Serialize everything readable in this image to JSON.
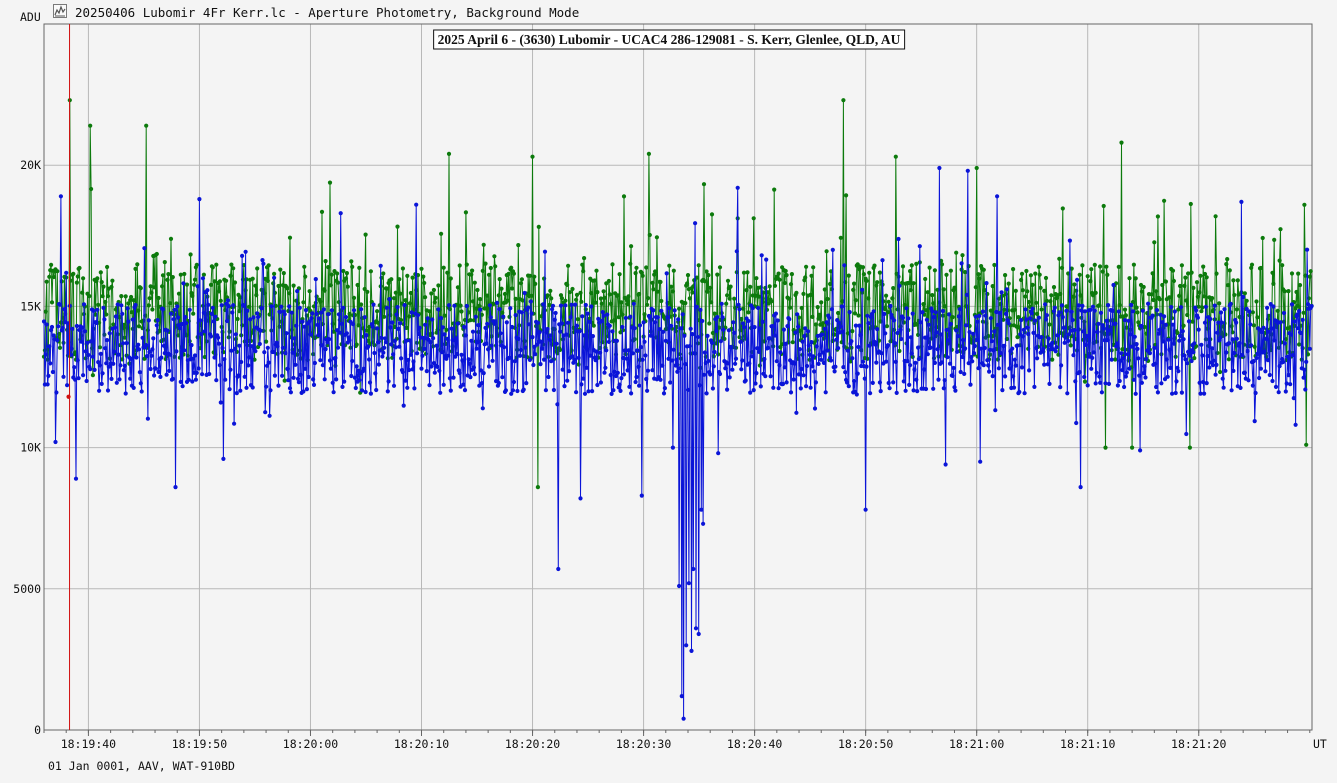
{
  "window": {
    "title": "20250406 Lubomir 4Fr Kerr.lc - Aperture Photometry, Background Mode",
    "app_icon": "lightcurve-app-icon"
  },
  "footer": {
    "info": "01 Jan 0001, AAV, WAT-910BD"
  },
  "colors": {
    "target": "#0a14d8",
    "comparison": "#0c7a0c",
    "marker": "#d01010",
    "grid": "#b8b8b8",
    "axis": "#666666",
    "background": "#f4f4f4"
  },
  "chart_data": {
    "type": "line",
    "title": "2025 April 6 - (3630) Lubomir - UCAC4 286-129081 - S. Kerr, Glenlee, QLD, AU",
    "ylabel": "ADU",
    "xlabel": "UT",
    "ylim": [
      0,
      25000
    ],
    "yticks": [
      0,
      5000,
      10000,
      15000,
      20000
    ],
    "ytick_labels": [
      "0",
      "5000",
      "10K",
      "15K",
      "20K"
    ],
    "xlim": [
      "18:19:36.0",
      "18:21:30.2"
    ],
    "xticks": [
      "18:19:40",
      "18:19:50",
      "18:20:00",
      "18:20:10",
      "18:20:20",
      "18:20:30",
      "18:20:40",
      "18:20:50",
      "18:21:00",
      "18:21:10",
      "18:21:20"
    ],
    "grid": true,
    "legend": "none",
    "marker_time": "18:19:38.3",
    "event": {
      "start": "18:20:33.2",
      "end": "18:20:35.4",
      "values": [
        5100,
        1200,
        400,
        3000,
        5200,
        2800,
        5700,
        3600,
        3400,
        7800,
        7300
      ]
    },
    "series": [
      {
        "label": "target",
        "color": "#0a14d8",
        "time_start": "18:19:36.0",
        "time_step_s": 0.08,
        "base": 13500,
        "spread": 1600,
        "min": 8500,
        "max": 19900,
        "deep_dips": [
          [
            "18:19:37.0",
            10200
          ],
          [
            "18:19:38.9",
            8900
          ],
          [
            "18:19:47.8",
            8600
          ],
          [
            "18:19:52.2",
            9600
          ],
          [
            "18:20:22.3",
            5700
          ],
          [
            "18:20:24.3",
            8200
          ],
          [
            "18:20:29.8",
            8300
          ],
          [
            "18:20:32.6",
            10000
          ],
          [
            "18:20:36.7",
            9800
          ],
          [
            "18:20:50.0",
            7800
          ],
          [
            "18:20:57.2",
            9400
          ],
          [
            "18:21:00.3",
            9500
          ],
          [
            "18:21:09.4",
            8600
          ],
          [
            "18:21:14.7",
            9900
          ]
        ],
        "peaks": [
          [
            "18:19:37.5",
            18900
          ],
          [
            "18:19:50.0",
            18800
          ],
          [
            "18:20:02.7",
            18300
          ],
          [
            "18:20:09.5",
            18600
          ],
          [
            "18:20:38.5",
            19200
          ],
          [
            "18:20:56.6",
            19900
          ],
          [
            "18:20:59.2",
            19800
          ],
          [
            "18:21:01.8",
            18900
          ],
          [
            "18:21:23.8",
            18700
          ]
        ]
      },
      {
        "label": "comparison",
        "color": "#0c7a0c",
        "time_start": "18:19:36.0",
        "time_step_s": 0.08,
        "base": 14800,
        "spread": 1700,
        "min": 8600,
        "max": 22300,
        "deep_dips": [
          [
            "18:20:20.5",
            8600
          ],
          [
            "18:21:11.6",
            10000
          ],
          [
            "18:21:14.0",
            10000
          ],
          [
            "18:21:19.2",
            10000
          ],
          [
            "18:21:29.7",
            10100
          ]
        ],
        "peaks": [
          [
            "18:19:38.3",
            22300
          ],
          [
            "18:19:40.2",
            21400
          ],
          [
            "18:19:45.2",
            21400
          ],
          [
            "18:20:12.5",
            20400
          ],
          [
            "18:20:20.0",
            20300
          ],
          [
            "18:20:30.5",
            20400
          ],
          [
            "18:20:48.0",
            22300
          ],
          [
            "18:20:52.7",
            20300
          ],
          [
            "18:21:13.0",
            20800
          ],
          [
            "18:21:00.0",
            19900
          ]
        ]
      }
    ]
  }
}
